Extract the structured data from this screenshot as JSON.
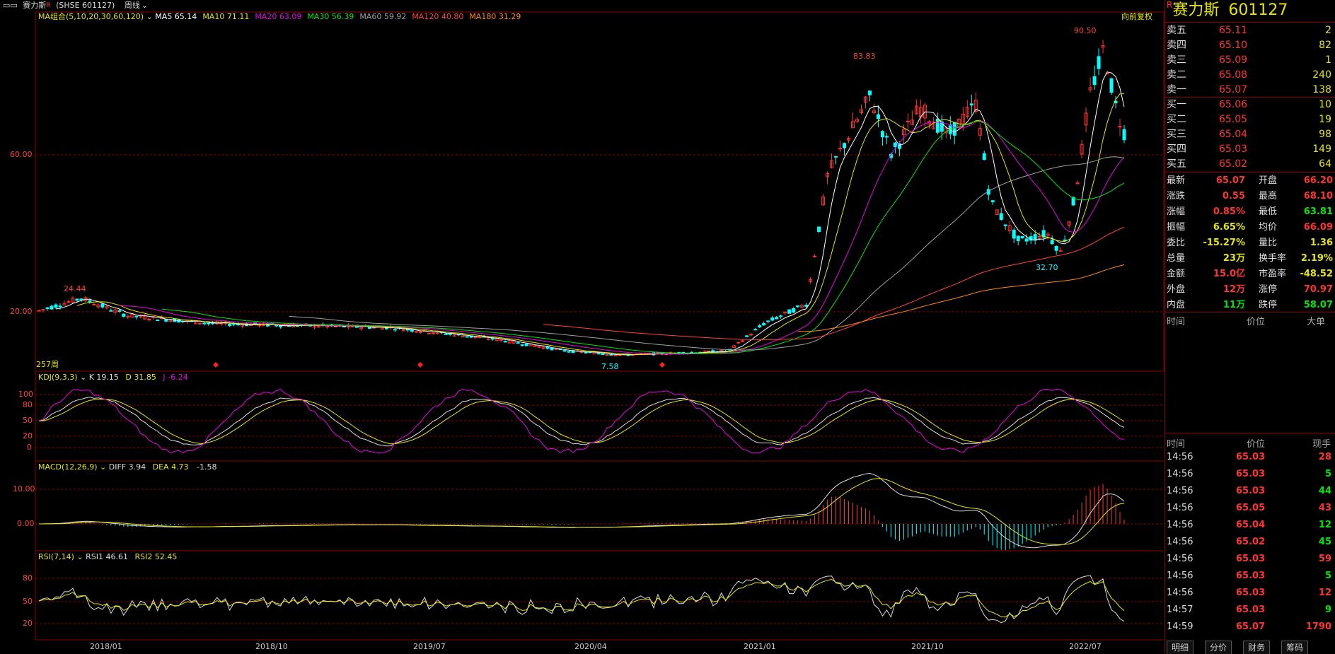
{
  "window": {
    "title": "赛力斯",
    "code_label": "(SHSE 601127)",
    "period": "周线"
  },
  "main_chart": {
    "ma_label": "MA组合(5,10,20,30,60,120)",
    "ma_values": [
      {
        "text": "MA5 65.14",
        "color": "#ffffff"
      },
      {
        "text": "MA10 71.11",
        "color": "#e6e600"
      },
      {
        "text": "MA20 63.09",
        "color": "#e600e6"
      },
      {
        "text": "MA30 56.39",
        "color": "#00e600"
      },
      {
        "text": "MA60 59.92",
        "color": "#a0a0a0"
      },
      {
        "text": "MA120 40.80",
        "color": "#ff4040"
      },
      {
        "text": "MA180 31.29",
        "color": "#ff8c00"
      }
    ],
    "fq_label": "向前复权",
    "price_levels": [
      "60.00",
      "20.00"
    ],
    "annotations": {
      "high1": "24.44",
      "low1": "7.58",
      "high2": "83.83",
      "high3": "90.50",
      "low2": "32.70"
    },
    "bars_label": "257周"
  },
  "kdj": {
    "label": "KDJ(9,3,3)",
    "K": "K 19.15",
    "D": "D 31.85",
    "J": "J -6.24",
    "levels": [
      "100",
      "80",
      "50",
      "20",
      "0"
    ]
  },
  "macd": {
    "label": "MACD(12,26,9)",
    "diff": "DIFF 3.94",
    "dea": "DEA 4.73",
    "macd": "-1.58",
    "levels": [
      "10.00",
      "0.00"
    ]
  },
  "rsi": {
    "label": "RSI(7,14)",
    "rsi1": "RSI1 46.61",
    "rsi2": "RSI2 52.45",
    "levels": [
      "80",
      "50",
      "20"
    ]
  },
  "x_axis": [
    "2018/01",
    "2018/10",
    "2019/07",
    "2020/04",
    "2021/01",
    "2021/10",
    "2022/07"
  ],
  "quote": {
    "name": "赛力斯",
    "code": "601127",
    "asks": [
      {
        "label": "卖五",
        "price": "65.11",
        "vol": "2"
      },
      {
        "label": "卖四",
        "price": "65.10",
        "vol": "82"
      },
      {
        "label": "卖三",
        "price": "65.09",
        "vol": "1"
      },
      {
        "label": "卖二",
        "price": "65.08",
        "vol": "240"
      },
      {
        "label": "卖一",
        "price": "65.07",
        "vol": "138"
      }
    ],
    "bids": [
      {
        "label": "买一",
        "price": "65.06",
        "vol": "10"
      },
      {
        "label": "买二",
        "price": "65.05",
        "vol": "19"
      },
      {
        "label": "买三",
        "price": "65.04",
        "vol": "98"
      },
      {
        "label": "买四",
        "price": "65.03",
        "vol": "149"
      },
      {
        "label": "买五",
        "price": "65.02",
        "vol": "64"
      }
    ],
    "stats": [
      {
        "l1": "最新",
        "v1": "65.07",
        "c1": "red",
        "l2": "开盘",
        "v2": "66.20",
        "c2": "red"
      },
      {
        "l1": "涨跌",
        "v1": "0.55",
        "c1": "red",
        "l2": "最高",
        "v2": "68.10",
        "c2": "red"
      },
      {
        "l1": "涨幅",
        "v1": "0.85%",
        "c1": "red",
        "l2": "最低",
        "v2": "63.81",
        "c2": "green"
      },
      {
        "l1": "振幅",
        "v1": "6.65%",
        "c1": "yellow",
        "l2": "均价",
        "v2": "66.09",
        "c2": "red"
      },
      {
        "l1": "委比",
        "v1": "-15.27%",
        "c1": "yellow",
        "l2": "量比",
        "v2": "1.36",
        "c2": "yellow"
      },
      {
        "l1": "总量",
        "v1": "23万",
        "c1": "yellow",
        "l2": "换手率",
        "v2": "2.19%",
        "c2": "yellow"
      },
      {
        "l1": "金额",
        "v1": "15.0亿",
        "c1": "red",
        "l2": "市盈率",
        "v2": "-48.52",
        "c2": "yellow"
      },
      {
        "l1": "外盘",
        "v1": "12万",
        "c1": "red",
        "l2": "涨停",
        "v2": "70.97",
        "c2": "red"
      },
      {
        "l1": "内盘",
        "v1": "11万",
        "c1": "green",
        "l2": "跌停",
        "v2": "58.07",
        "c2": "green"
      }
    ],
    "big_header": {
      "time": "时间",
      "price": "价位",
      "big": "大单"
    },
    "ticks_header": {
      "time": "时间",
      "price": "价位",
      "vol": "现手"
    },
    "ticks": [
      {
        "time": "14:56",
        "price": "65.03",
        "vol": "28",
        "vc": "red"
      },
      {
        "time": "14:56",
        "price": "65.03",
        "vol": "5",
        "vc": "green"
      },
      {
        "time": "14:56",
        "price": "65.03",
        "vol": "44",
        "vc": "green"
      },
      {
        "time": "14:56",
        "price": "65.05",
        "vol": "43",
        "vc": "red"
      },
      {
        "time": "14:56",
        "price": "65.04",
        "vol": "12",
        "vc": "green"
      },
      {
        "time": "14:56",
        "price": "65.02",
        "vol": "45",
        "vc": "green"
      },
      {
        "time": "14:56",
        "price": "65.03",
        "vol": "59",
        "vc": "red"
      },
      {
        "time": "14:56",
        "price": "65.03",
        "vol": "5",
        "vc": "green"
      },
      {
        "time": "14:56",
        "price": "65.03",
        "vol": "12",
        "vc": "red"
      },
      {
        "time": "14:57",
        "price": "65.03",
        "vol": "9",
        "vc": "green"
      },
      {
        "time": "14:59",
        "price": "65.07",
        "vol": "1790",
        "vc": "red"
      }
    ],
    "tabs": [
      "明细",
      "分价",
      "财务",
      "筹码"
    ]
  },
  "colors": {
    "up": "#ff3333",
    "down": "#00ffff",
    "grid": "#8b0000",
    "ma5": "#ffffff",
    "ma10": "#e6e600",
    "ma20": "#e600e6",
    "ma30": "#00e600",
    "ma60": "#a0a0a0",
    "ma120": "#ff4040",
    "ma180": "#ff8c00"
  }
}
